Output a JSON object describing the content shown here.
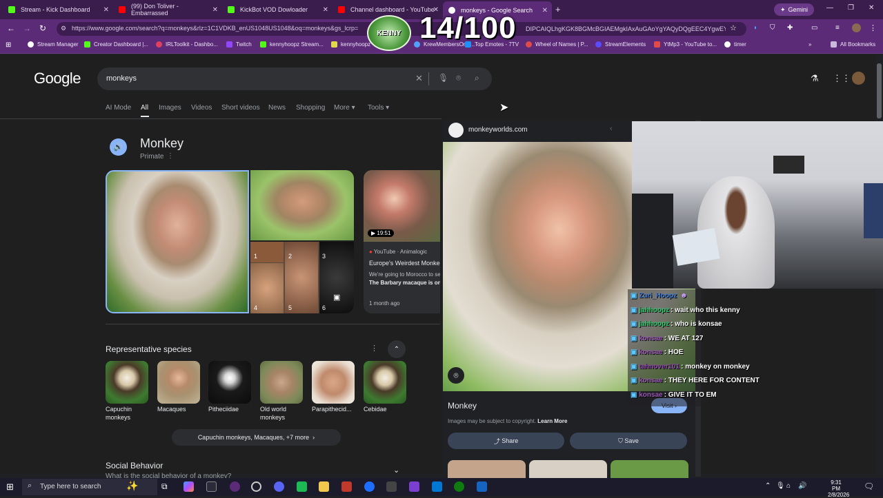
{
  "tabs": [
    {
      "label": "Stream - Kick Dashboard",
      "color": "#53fc18"
    },
    {
      "label": "(99) Don Toliver - Embarrassed",
      "color": "#ff0000"
    },
    {
      "label": "KickBot VOD Dowloader",
      "color": "#53fc18"
    },
    {
      "label": "Channel dashboard - YouTube",
      "color": "#ff0000"
    },
    {
      "label": "monkeys - Google Search",
      "color": "#ffffff"
    }
  ],
  "gemini_label": "Gemini",
  "url": "https://www.google.com/search?q=monkeys&rlz=1C1VDKB_enUS1048US1048&oq=monkeys&gs_lcrp=",
  "url_tail": "DIPCAIQLhgKGK8BGMcBGIAEMgkIAxAuGAoYgYAQyDQgEEC4YgwEYs...",
  "bookmarks": [
    "Stream Manager",
    "Creator Dashboard |...",
    "IRLToolkit - Dashbo...",
    "Twitch",
    "kennyhoopz Stream...",
    "kennyhoopz",
    "KrewMembersOnly...",
    "Top Emotes - 7TV",
    "Wheel of Names | P...",
    "StreamElements",
    "YtMp3 - YouTube to...",
    "timer"
  ],
  "all_bookmarks": "All Bookmarks",
  "overlay": {
    "counter": "14/100",
    "logo": "KENNY"
  },
  "google": {
    "logo": "Google",
    "query": "monkeys",
    "nav": [
      "AI Mode",
      "All",
      "Images",
      "Videos",
      "Short videos",
      "News",
      "Shopping",
      "More",
      "Tools"
    ],
    "entity_title": "Monkey",
    "entity_sub": "Primate",
    "video": {
      "duration": "19:51",
      "source": "YouTube · Animalogic",
      "title": "Europe's Weirdest Monke",
      "desc1": "We're going to Morocco to se",
      "desc2": "The Barbary macaque is one",
      "age": "1 month ago"
    },
    "grid_nums": [
      "1",
      "2",
      "3",
      "4",
      "5",
      "6"
    ],
    "species_heading": "Representative species",
    "species": [
      "Capuchin monkeys",
      "Macaques",
      "Pitheciidae",
      "Old world monkeys",
      "Parapithecid...",
      "Cebidae"
    ],
    "species_more": "Capuchin monkeys, Macaques, +7 more",
    "social_heading": "Social Behavior",
    "social_q": "What is the social behavior of a monkey?"
  },
  "panel": {
    "site": "monkeyworlds.com",
    "title": "Monkey",
    "copyright": "Images may be subject to copyright.",
    "learn_more": "Learn More",
    "visit": "Visit",
    "share": "Share",
    "save": "Save"
  },
  "chat": [
    {
      "user": "Zuri_Hoopz",
      "msg": "",
      "color": "#3a7bd5"
    },
    {
      "user": "jahhoopz",
      "msg": ": wait who this kenny",
      "color": "#2ecc71"
    },
    {
      "user": "jahhoopz",
      "msg": ": who is konsae",
      "color": "#2ecc71"
    },
    {
      "user": "konsae",
      "msg": ": WE AT 127",
      "color": "#9b59b6"
    },
    {
      "user": "konsae",
      "msg": ": HOE",
      "color": "#9b59b6"
    },
    {
      "user": "tahnover101",
      "msg": ": monkey on monkey",
      "color": "#8e44ad"
    },
    {
      "user": "konsae",
      "msg": ": THEY HERE FOR CONTENT",
      "color": "#9b59b6"
    },
    {
      "user": "konsae",
      "msg": ": GIVE IT TO EM",
      "color": "#9b59b6"
    }
  ],
  "taskbar": {
    "search": "Type here to search",
    "time": "9:31 PM",
    "date": "2/8/2026"
  }
}
